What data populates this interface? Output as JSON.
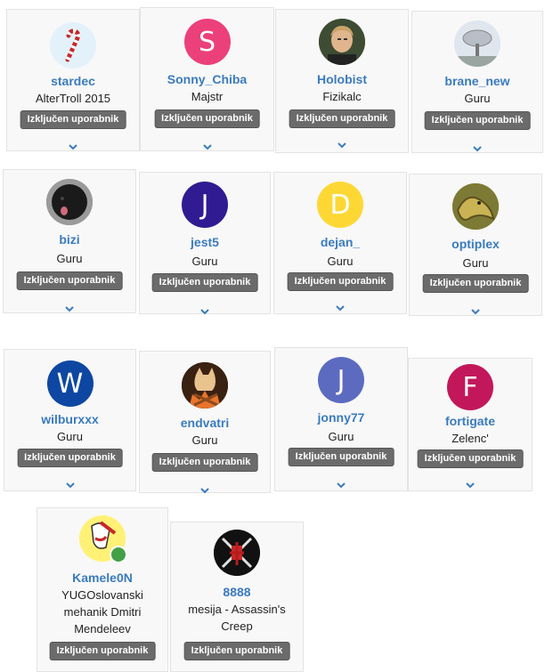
{
  "button_label": "Izključen uporabnik",
  "users": [
    {
      "name": "stardec",
      "rank": "AlterTroll 2015",
      "avatar": "candy-cane-avatar"
    },
    {
      "name": "Sonny_Chiba",
      "rank": "Majstr",
      "avatar": "letter-avatar",
      "initial": "S",
      "color": "#ec407a"
    },
    {
      "name": "Holobist",
      "rank": "Fizikalc",
      "avatar": "person-photo-avatar"
    },
    {
      "name": "brane_new",
      "rank": "Guru",
      "avatar": "radio-dish-avatar"
    },
    {
      "name": "bizi",
      "rank": "Guru",
      "avatar": "black-dog-avatar"
    },
    {
      "name": "jest5",
      "rank": "Guru",
      "avatar": "letter-avatar",
      "initial": "J",
      "color": "#311b92"
    },
    {
      "name": "dejan_",
      "rank": "Guru",
      "avatar": "letter-avatar",
      "initial": "D",
      "color": "#fdd835"
    },
    {
      "name": "optiplex",
      "rank": "Guru",
      "avatar": "snake-avatar"
    },
    {
      "name": "wilburxxx",
      "rank": "Guru",
      "avatar": "letter-avatar",
      "initial": "W",
      "color": "#0d47a1"
    },
    {
      "name": "endvatri",
      "rank": "Guru",
      "avatar": "cat-fire-avatar"
    },
    {
      "name": "jonny77",
      "rank": "Guru",
      "avatar": "letter-avatar",
      "initial": "J",
      "color": "#5c6bc0"
    },
    {
      "name": "fortigate",
      "rank": "Zelenc'",
      "avatar": "letter-avatar",
      "initial": "F",
      "color": "#c2185b"
    },
    {
      "name": "Kamele0N",
      "rank": "YUGOslovanski mehanik Dmitri Mendeleev",
      "avatar": "cartoon-avatar"
    },
    {
      "name": "8888",
      "rank": "mesija - Assassin's Creep",
      "avatar": "assassin-emblem-avatar"
    }
  ]
}
